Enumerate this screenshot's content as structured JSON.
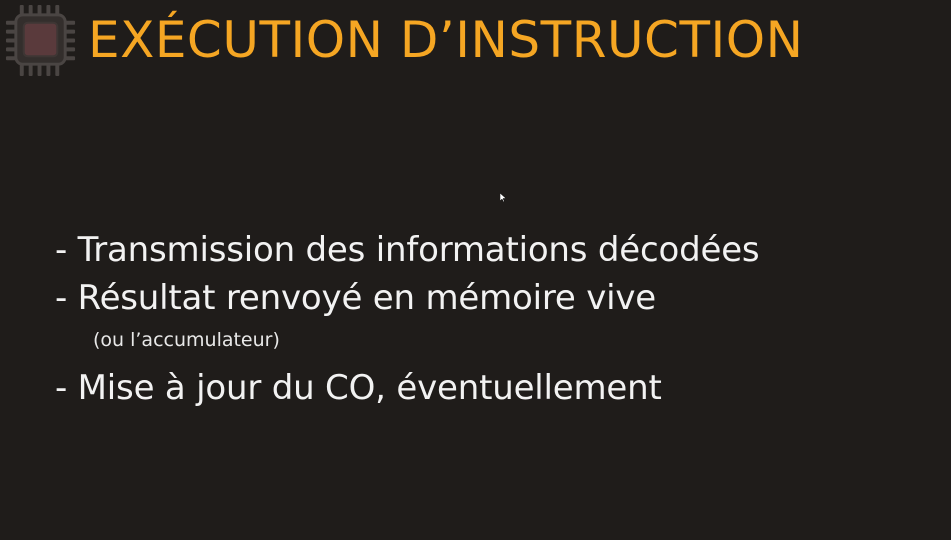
{
  "slide": {
    "title": "EXÉCUTION D’INSTRUCTION",
    "accent_color": "#f5a623",
    "logo_icon": "cpu-chip-icon",
    "items": [
      "- Transmission des informations décodées",
      "- Résultat renvoyé en mémoire vive",
      "(ou l’accumulateur)",
      "- Mise à jour du CO, éventuellement"
    ]
  }
}
